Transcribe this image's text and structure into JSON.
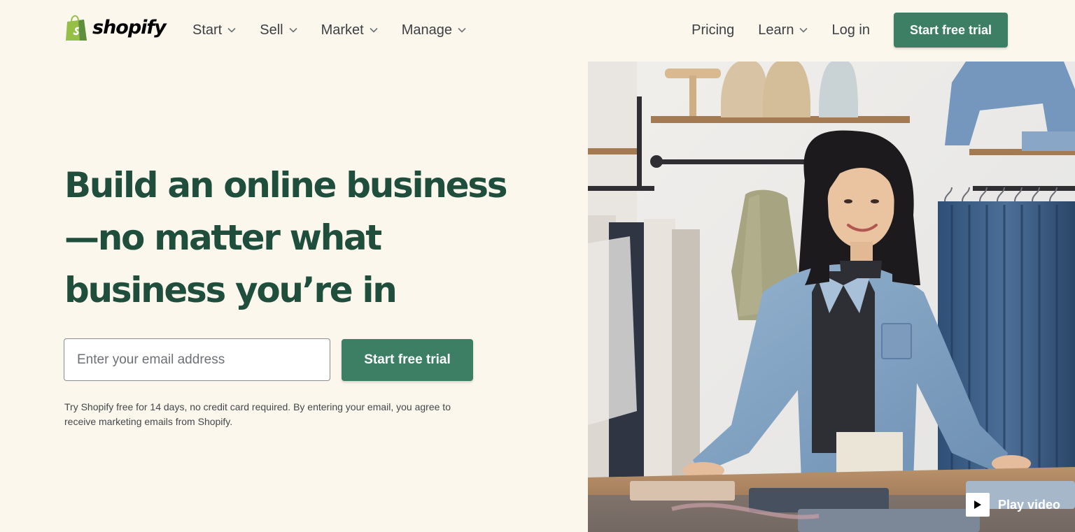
{
  "brand": {
    "name": "shopify",
    "logo_icon": "shopping-bag-icon",
    "color": "#95bf47"
  },
  "nav": {
    "left": [
      {
        "label": "Start",
        "has_dropdown": true
      },
      {
        "label": "Sell",
        "has_dropdown": true
      },
      {
        "label": "Market",
        "has_dropdown": true
      },
      {
        "label": "Manage",
        "has_dropdown": true
      }
    ],
    "right": {
      "pricing": "Pricing",
      "learn": "Learn",
      "login": "Log in",
      "cta": "Start free trial"
    }
  },
  "hero": {
    "headline": [
      "Build an online business",
      "—no matter what",
      "business you’re in"
    ],
    "email_placeholder": "Enter your email address",
    "cta": "Start free trial",
    "disclaimer_line1": "Try Shopify free for 14 days, no credit card required. By entering your email, you agree to",
    "disclaimer_line2": "receive marketing emails from Shopify.",
    "video_label": "Play video"
  },
  "colors": {
    "background": "#fbf7ed",
    "accent": "#3d7f65",
    "headline": "#1f4e3d"
  }
}
